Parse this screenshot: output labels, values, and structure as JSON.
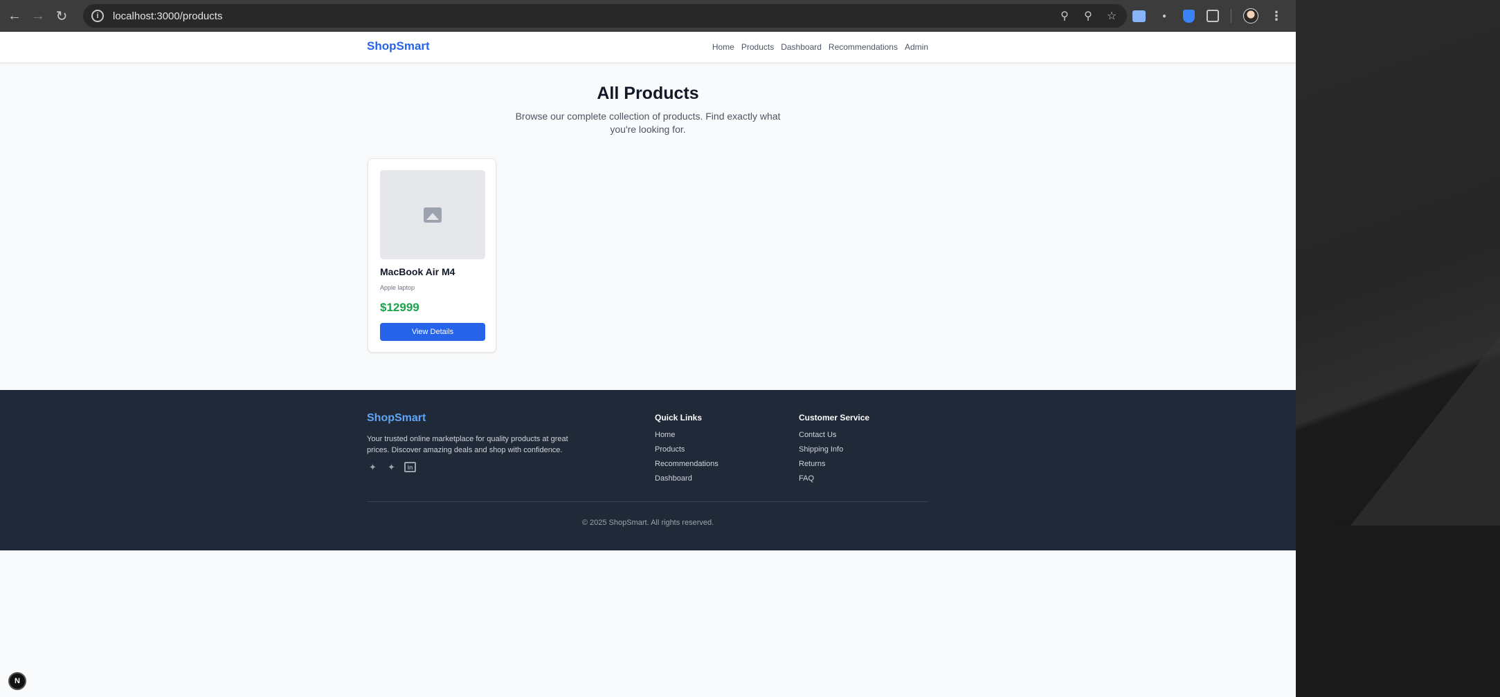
{
  "browser": {
    "url": "localhost:3000/products",
    "info_icon": "i"
  },
  "header": {
    "brand": "ShopSmart",
    "nav": [
      "Home",
      "Products",
      "Dashboard",
      "Recommendations",
      "Admin"
    ]
  },
  "main": {
    "title": "All Products",
    "subtitle": "Browse our complete collection of products. Find exactly what you're looking for."
  },
  "products": [
    {
      "name": "MacBook Air M4",
      "description": "Apple laptop",
      "price": "$12999",
      "button": "View Details"
    }
  ],
  "footer": {
    "brand": "ShopSmart",
    "about": "Your trusted online marketplace for quality products at great prices. Discover amazing deals and shop with confidence.",
    "quick_links": {
      "title": "Quick Links",
      "items": [
        "Home",
        "Products",
        "Recommendations",
        "Dashboard"
      ]
    },
    "customer_service": {
      "title": "Customer Service",
      "items": [
        "Contact Us",
        "Shipping Info",
        "Returns",
        "FAQ"
      ]
    },
    "copyright": "© 2025 ShopSmart. All rights reserved."
  },
  "dev_badge": "N",
  "colors": {
    "brand_blue": "#2563eb",
    "price_green": "#16a34a",
    "footer_bg": "#1f2937",
    "footer_brand": "#60a5fa"
  }
}
